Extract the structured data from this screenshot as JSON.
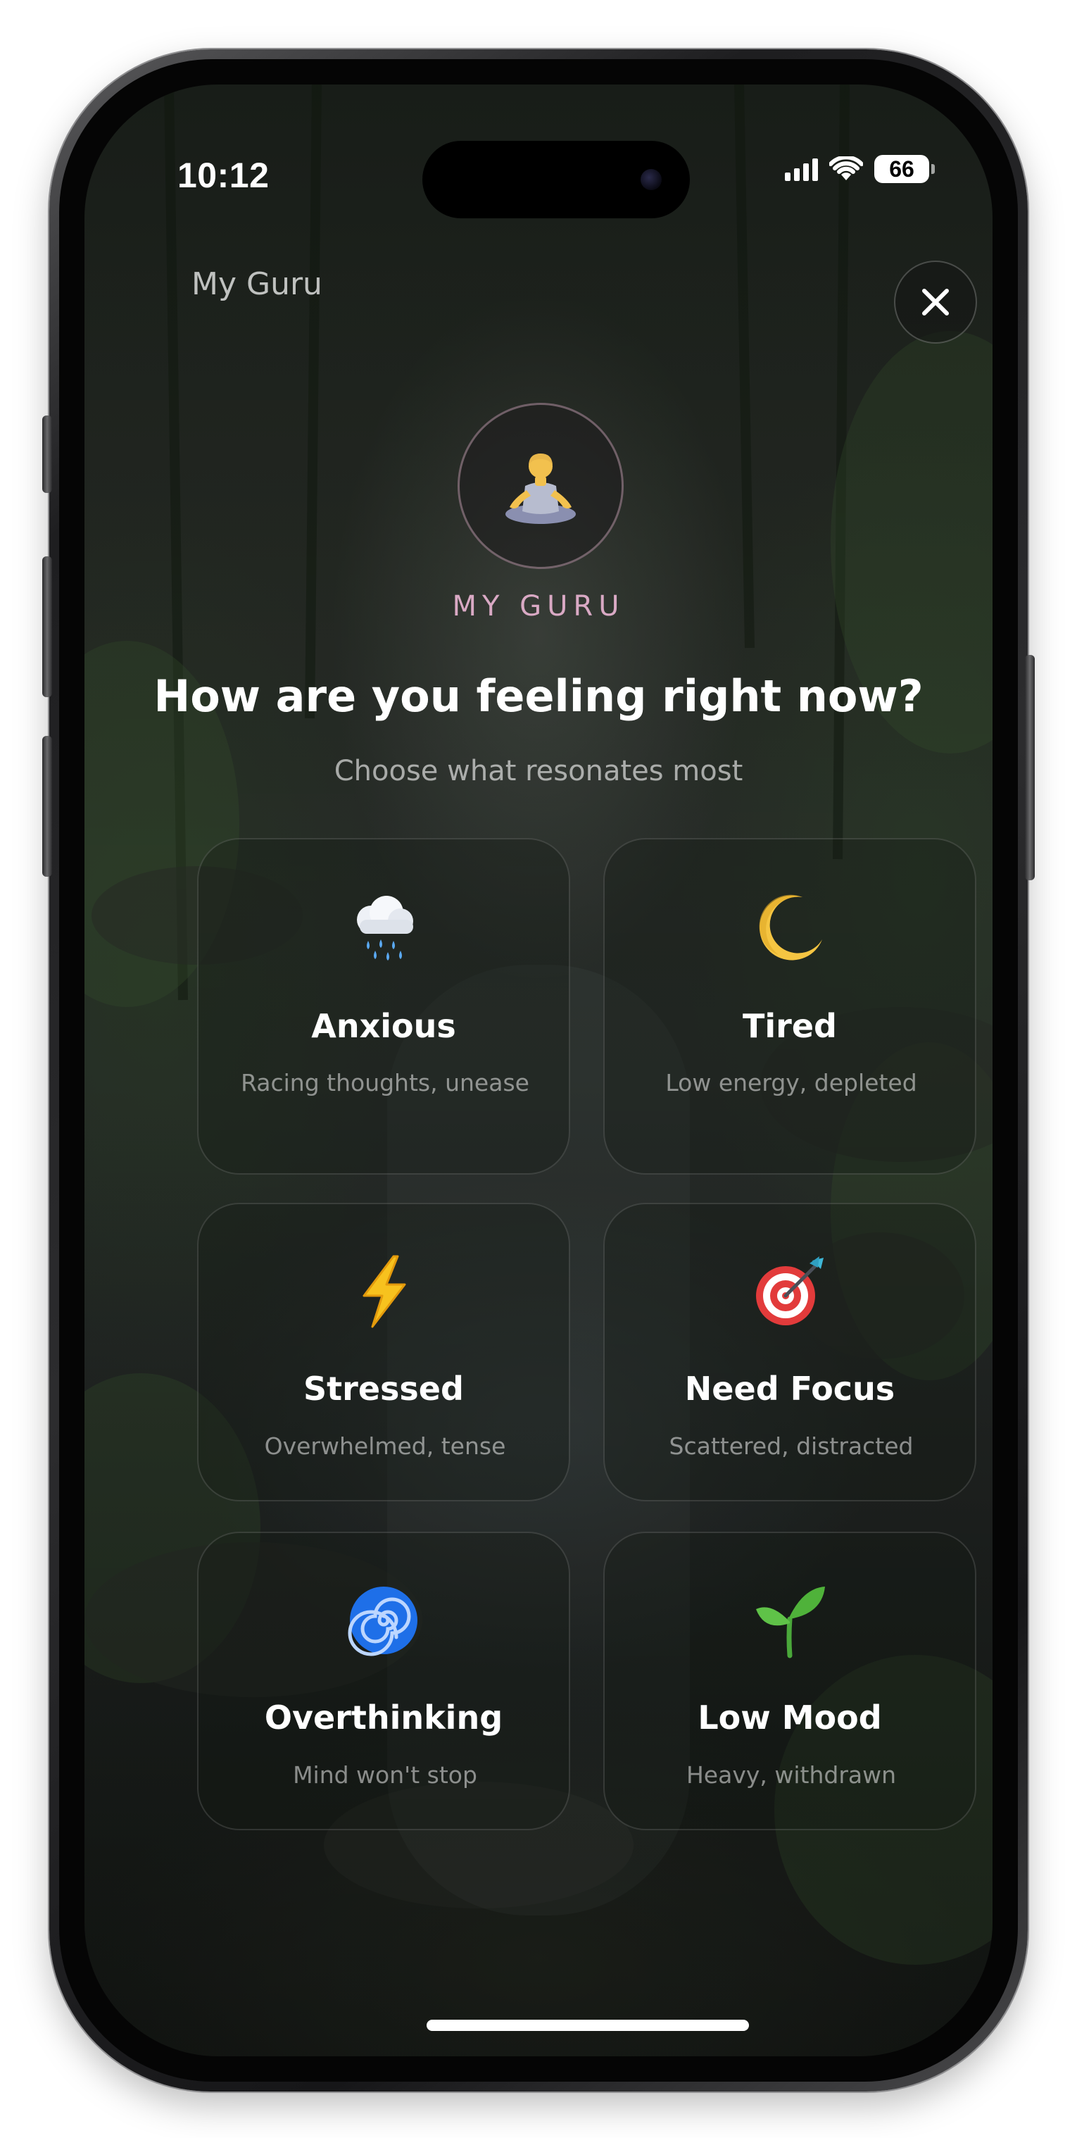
{
  "status_bar": {
    "time": "10:12",
    "battery": "66"
  },
  "header": {
    "title": "My Guru",
    "close_icon": "close-icon"
  },
  "guru": {
    "avatar_icon": "meditating-person-icon",
    "label": "MY GURU"
  },
  "prompt": {
    "question": "How are you feeling right now?",
    "subtitle": "Choose what resonates most"
  },
  "moods": [
    {
      "icon": "rain-cloud-icon",
      "label": "Anxious",
      "description": "Racing thoughts, unease"
    },
    {
      "icon": "crescent-moon-icon",
      "label": "Tired",
      "description": "Low energy, depleted"
    },
    {
      "icon": "lightning-icon",
      "label": "Stressed",
      "description": "Overwhelmed, tense"
    },
    {
      "icon": "target-icon",
      "label": "Need Focus",
      "description": "Scattered, distracted"
    },
    {
      "icon": "spiral-icon",
      "label": "Overthinking",
      "description": "Mind won't stop"
    },
    {
      "icon": "seedling-icon",
      "label": "Low Mood",
      "description": "Heavy, withdrawn"
    }
  ],
  "colors": {
    "accent": "#d9a9c4",
    "text": "#ffffff",
    "card_border": "rgba(255,255,255,0.13)"
  }
}
